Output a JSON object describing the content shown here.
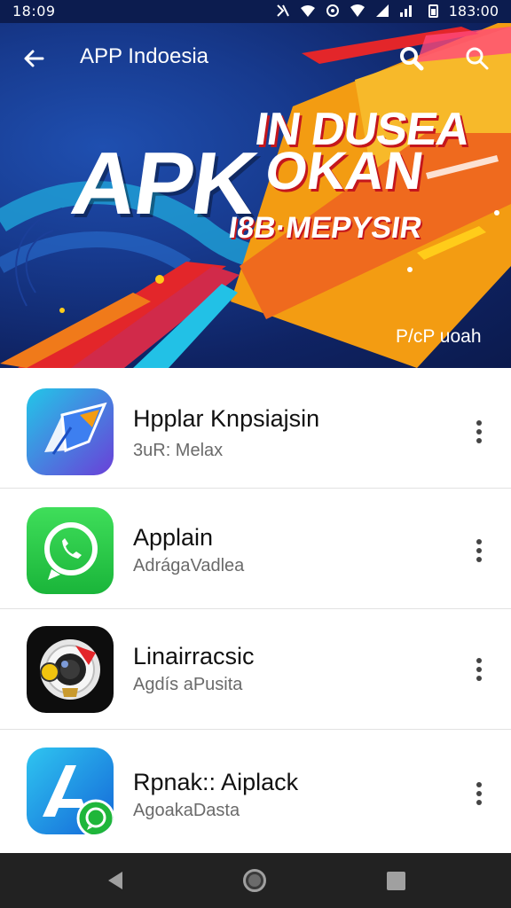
{
  "status_bar": {
    "time_left": "18:09",
    "time_right": "183:00"
  },
  "app_bar": {
    "title": "APP Indoesia"
  },
  "banner": {
    "headline_main": "APK",
    "headline_top": "IN DUSEA",
    "headline_mid": "OKAN",
    "headline_sub": "I8B·MEPYSIR",
    "caption": "P/cP uoah",
    "colors": {
      "blue_dark": "#0f2363",
      "orange": "#f39c12",
      "red": "#e3262a",
      "yellow": "#ffcc1a"
    }
  },
  "apps": [
    {
      "name": "Hpplar Knpsiajsin",
      "subtitle": "3uR: Melax",
      "icon": "blue-gradient-app-icon"
    },
    {
      "name": "Applain",
      "subtitle": "AdrágaVadlea",
      "icon": "green-chat-app-icon"
    },
    {
      "name": "Linairracsic",
      "subtitle": "Agdís aPusita",
      "icon": "camera-lens-app-icon"
    },
    {
      "name": "Rpnak:: Aiplack",
      "subtitle": "AgoakaDasta",
      "icon": "blue-a-app-icon"
    }
  ],
  "nav_bar": {
    "items": [
      "back",
      "home",
      "recent-apps"
    ]
  }
}
